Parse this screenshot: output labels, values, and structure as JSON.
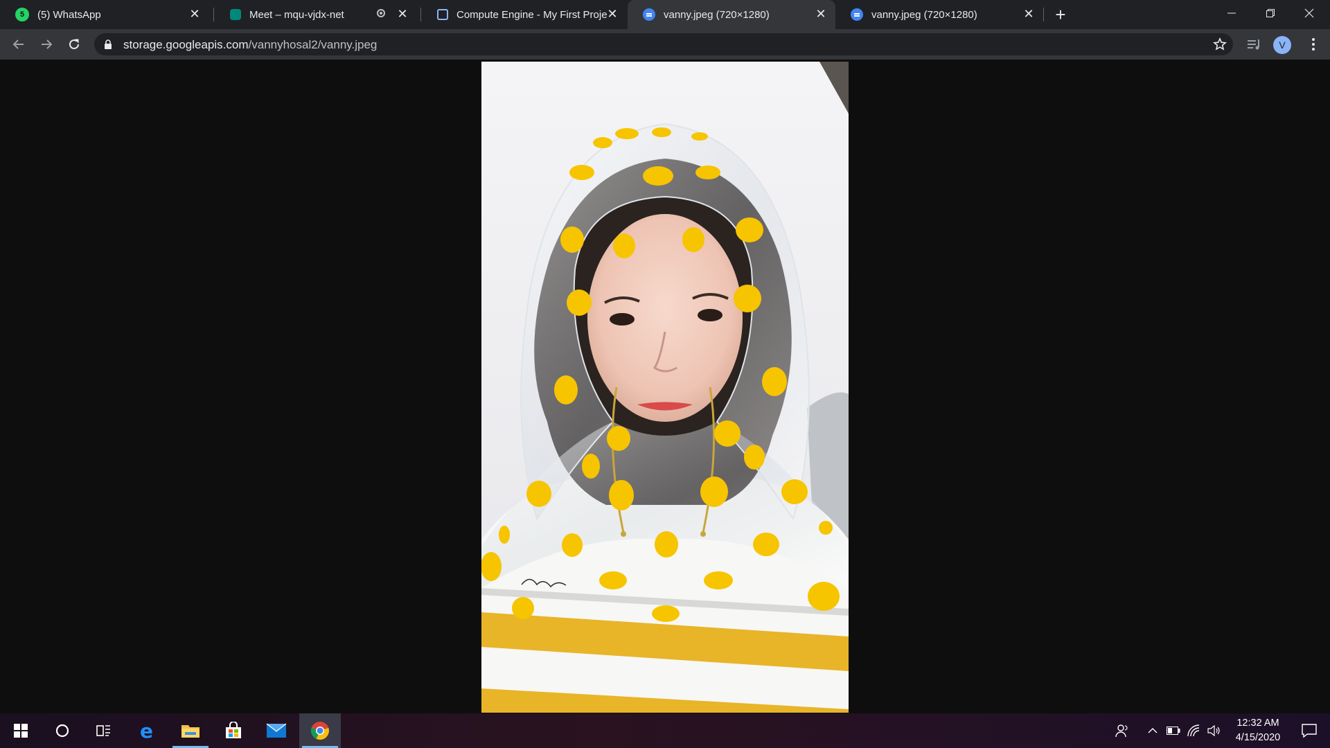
{
  "browser": {
    "tabs": [
      {
        "title": "(5) WhatsApp",
        "badge": "5",
        "favicon": "whatsapp-icon",
        "active": false
      },
      {
        "title": "Meet – mqu-vjdx-net",
        "favicon": "meet-icon",
        "recording": true,
        "active": false
      },
      {
        "title": "Compute Engine - My First Project",
        "favicon": "compute-engine-icon",
        "active": false
      },
      {
        "title": "vanny.jpeg (720×1280)",
        "favicon": "image-doc-icon",
        "active": true
      },
      {
        "title": "vanny.jpeg (720×1280)",
        "favicon": "image-doc-icon",
        "active": false
      }
    ],
    "address_bar": {
      "host": "storage.googleapis.com",
      "path": "/vannyhosal2/vanny.jpeg"
    },
    "profile_initial": "V"
  },
  "taskbar": {
    "apps": [
      "start-icon",
      "cortana-icon",
      "task-view-icon",
      "edge-icon",
      "file-explorer-icon",
      "store-icon",
      "mail-icon",
      "chrome-icon"
    ],
    "clock": {
      "time": "12:32 AM",
      "date": "4/15/2020"
    }
  },
  "colors": {
    "tab_strip": "#202124",
    "toolbar": "#35363a",
    "page_bg": "#0e0e0e",
    "accent_yellow": "#f7c400"
  }
}
